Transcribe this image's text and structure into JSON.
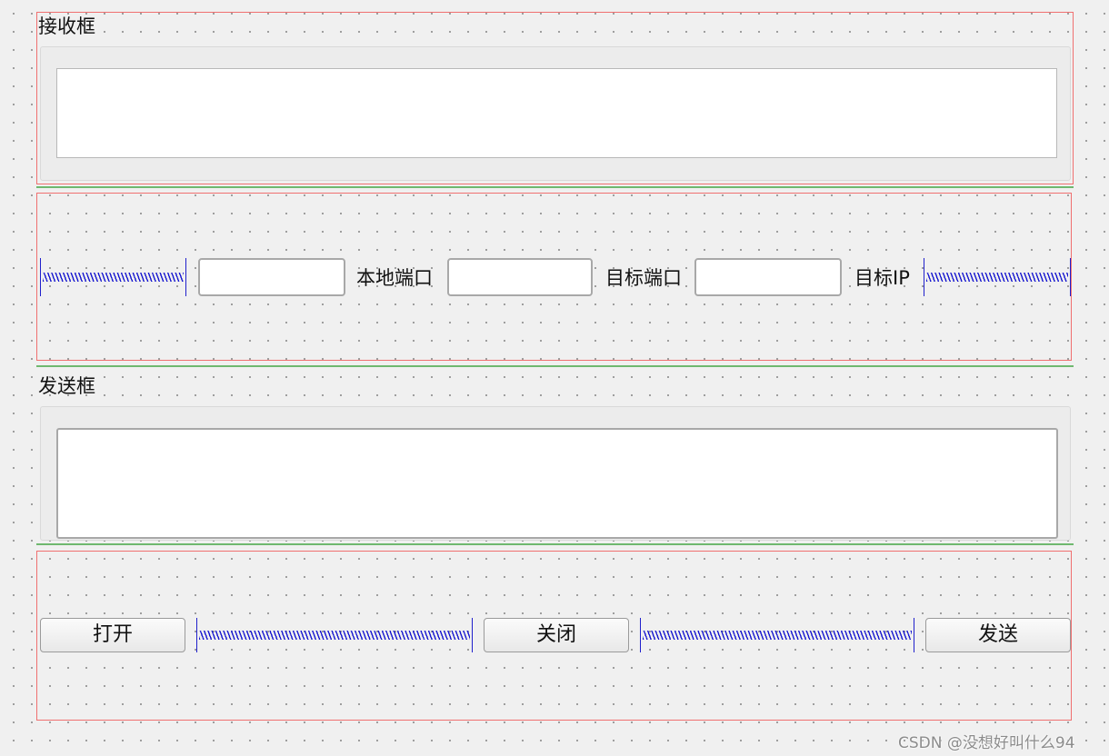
{
  "receive": {
    "title": "接收框",
    "content": ""
  },
  "network": {
    "local_port_label": "本地端口",
    "target_port_label": "目标端口",
    "target_ip_label": "目标IP",
    "field1_value": "",
    "field2_value": "",
    "field3_value": ""
  },
  "send": {
    "title": "发送框",
    "content": ""
  },
  "buttons": {
    "open": "打开",
    "close": "关闭",
    "send": "发送"
  },
  "watermark": "CSDN @没想好叫什么94",
  "colors": {
    "layout_border": "#f07070",
    "separator": "#6fb86f",
    "spacer": "#1a1ad0",
    "background": "#f0f0f0"
  }
}
